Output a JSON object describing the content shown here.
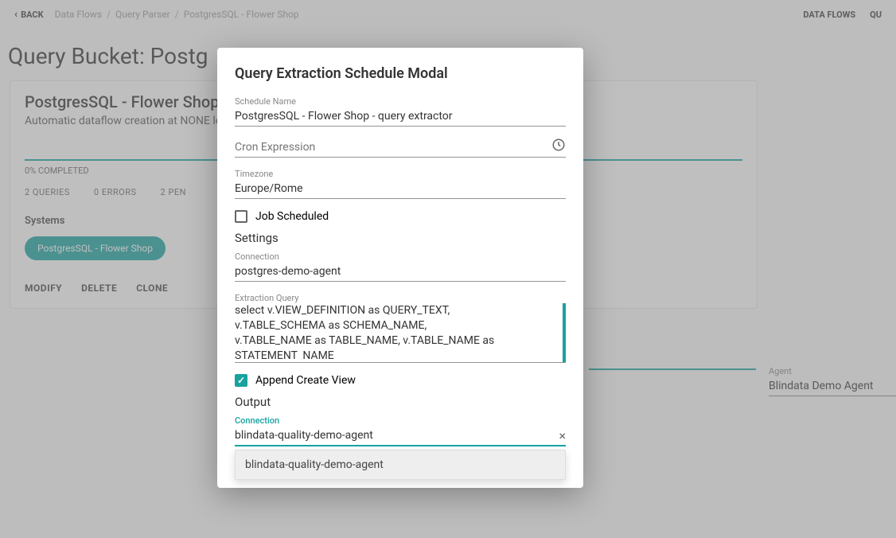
{
  "topbar": {
    "back": "BACK",
    "crumbs": [
      "Data Flows",
      "Query Parser",
      "PostgresSQL - Flower Shop"
    ],
    "rightnav": [
      "DATA FLOWS",
      "QU"
    ]
  },
  "page": {
    "title": "Query Bucket: Postg",
    "card_title": "PostgresSQL - Flower Shop",
    "card_sub": "Automatic dataflow creation at NONE le",
    "progress": "0% COMPLETED",
    "stats": {
      "queries": "2 QUERIES",
      "errors": "0 ERRORS",
      "pending": "2 PEN"
    },
    "systems_label": "Systems",
    "chip": "PostgresSQL - Flower Shop",
    "actions": [
      "MODIFY",
      "DELETE",
      "CLONE"
    ]
  },
  "agent_panel": {
    "label": "Agent",
    "value": "Blindata Demo Agent"
  },
  "modal": {
    "title": "Query Extraction Schedule Modal",
    "schedule_name_label": "Schedule Name",
    "schedule_name_value": "PostgresSQL - Flower Shop - query extractor",
    "cron_placeholder": "Cron Expression",
    "timezone_label": "Timezone",
    "timezone_value": "Europe/Rome",
    "job_scheduled": "Job Scheduled",
    "settings": "Settings",
    "connection1_label": "Connection",
    "connection1_value": "postgres-demo-agent",
    "extraction_query_label": "Extraction Query",
    "extraction_query_value": "select v.VIEW_DEFINITION as QUERY_TEXT,\n v.TABLE_SCHEMA as SCHEMA_NAME,\n v.TABLE_NAME as TABLE_NAME, v.TABLE_NAME as STATEMENT_NAME",
    "append_create_view": "Append Create View",
    "output": "Output",
    "connection2_label": "Connection",
    "connection2_value": "blindata-quality-demo-agent",
    "dropdown_option": "blindata-quality-demo-agent"
  }
}
